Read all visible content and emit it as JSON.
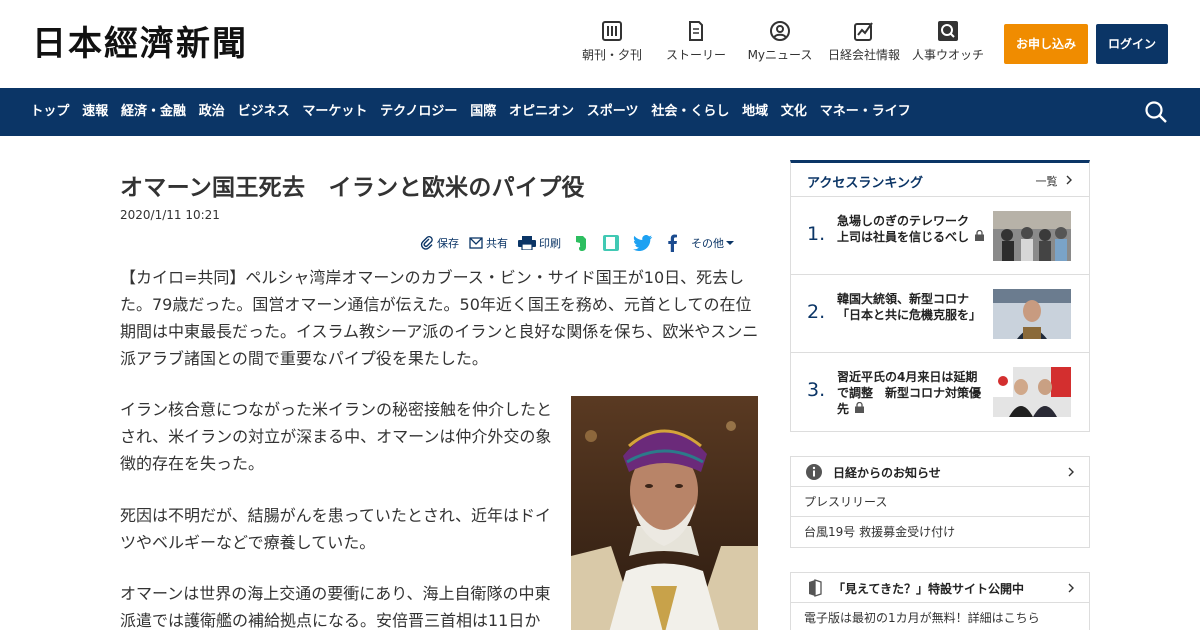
{
  "header": {
    "logo": "日本經濟新聞",
    "links": [
      {
        "label": "朝刊・夕刊",
        "icon": "newspaper-icon"
      },
      {
        "label": "ストーリー",
        "icon": "story-icon"
      },
      {
        "label": "Myニュース",
        "icon": "user-icon"
      },
      {
        "label": "日経会社情報",
        "icon": "chart-icon"
      },
      {
        "label": "人事ウオッチ",
        "icon": "search-person-icon"
      }
    ],
    "subscribe": "お申し込み",
    "login": "ログイン"
  },
  "nav": {
    "items": [
      "トップ",
      "速報",
      "経済・金融",
      "政治",
      "ビジネス",
      "マーケット",
      "テクノロジー",
      "国際",
      "オピニオン",
      "スポーツ",
      "社会・くらし",
      "地域",
      "文化",
      "マネー・ライフ"
    ]
  },
  "article": {
    "title": "オマーン国王死去　イランと欧米のパイプ役",
    "date": "2020/1/11 10:21",
    "share": {
      "save": "保存",
      "share": "共有",
      "print": "印刷",
      "more": "その他"
    },
    "paragraphs": [
      "【カイロ=共同】ペルシャ湾岸オマーンのカブース・ビン・サイド国王が10日、死去した。79歳だった。国営オマーン通信が伝えた。50年近く国王を務め、元首としての在位期間は中東最長だった。イスラム教シーア派のイランと良好な関係を保ち、欧米やスンニ派アラブ諸国との間で重要なパイプ役を果たした。",
      "イラン核合意につながった米イランの秘密接触を仲介したとされ、米イランの対立が深まる中、オマーンは仲介外交の象徴的存在を失った。",
      "死因は不明だが、結腸がんを患っていたとされ、近年はドイツやベルギーなどで療養していた。",
      "オマーンは世界の海上交通の要衝にあり、海上自衛隊の中東派遣では護衛艦の補給拠点になる。安倍晋三首相は11日から"
    ]
  },
  "ranking": {
    "title": "アクセスランキング",
    "more": "一覧",
    "items": [
      {
        "num": "1.",
        "text": "急場しのぎのテレワーク　上司は社員を信じるべし"
      },
      {
        "num": "2.",
        "text": "韓国大統領、新型コロナ「日本と共に危機克服を」"
      },
      {
        "num": "3.",
        "text": "習近平氏の4月来日は延期で調整　新型コロナ対策優先"
      }
    ]
  },
  "notice": {
    "title": "日経からのお知らせ",
    "items": [
      "プレスリリース",
      "台風19号 救援募金受け付け"
    ]
  },
  "promo": {
    "title": "「見えてきた？」特設サイト公開中",
    "items": [
      "電子版は最初の1カ月が無料！詳細はこちら"
    ]
  },
  "colors": {
    "navy": "#0b3566",
    "orange": "#f08c00"
  }
}
